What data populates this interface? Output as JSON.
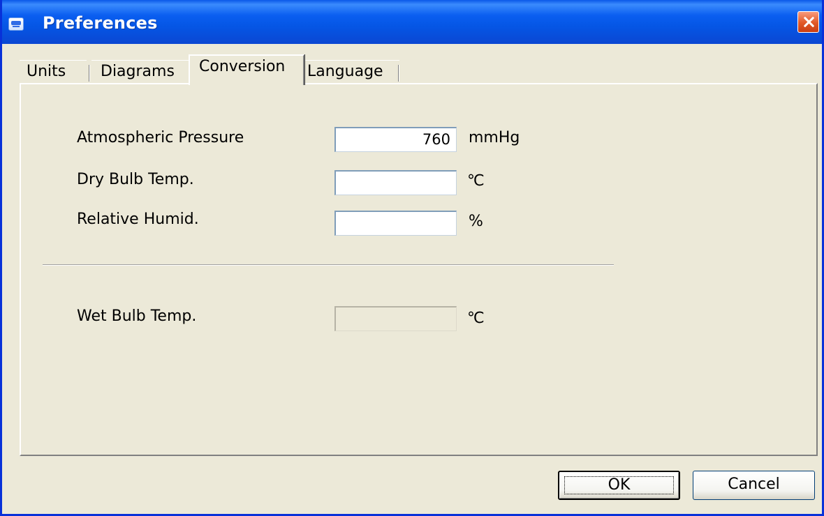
{
  "window": {
    "title": "Preferences",
    "icon": "app-icon",
    "close_icon": "close-icon"
  },
  "tabs": [
    {
      "label": "Units",
      "active": false
    },
    {
      "label": "Diagrams",
      "active": false
    },
    {
      "label": "Conversion",
      "active": true
    },
    {
      "label": "Language",
      "active": false
    }
  ],
  "conversion": {
    "atmospheric_pressure": {
      "label": "Atmospheric Pressure",
      "value": "760",
      "unit": "mmHg"
    },
    "dry_bulb_temp": {
      "label": "Dry Bulb Temp.",
      "value": "",
      "unit": "℃"
    },
    "relative_humid": {
      "label": "Relative Humid.",
      "value": "",
      "unit": "%"
    },
    "wet_bulb_temp": {
      "label": "Wet Bulb Temp.",
      "value": "",
      "unit": "℃",
      "disabled": true
    }
  },
  "buttons": {
    "ok": "OK",
    "cancel": "Cancel"
  },
  "colors": {
    "window_frame": "#0831d9",
    "dialog_background": "#ece9d8",
    "close_button": "#e15826"
  }
}
